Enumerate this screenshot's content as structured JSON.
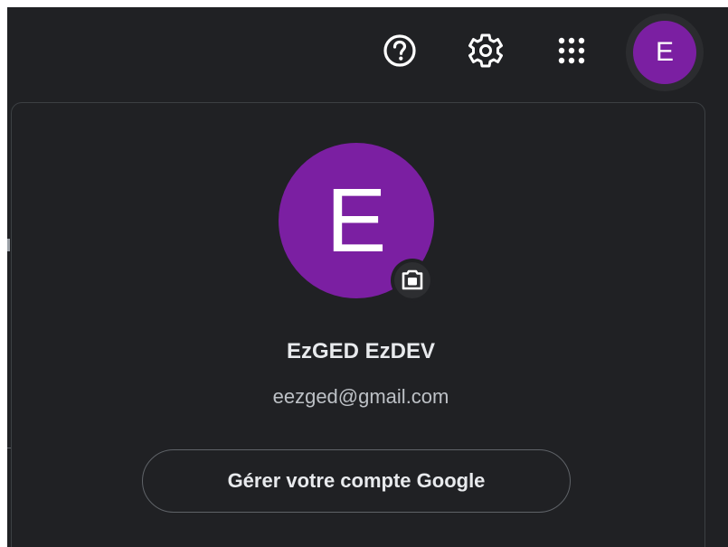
{
  "topbar": {
    "help_icon": "help-circle-icon",
    "settings_icon": "gear-icon",
    "apps_icon": "apps-grid-icon",
    "avatar_initial": "E",
    "avatar_color": "#7b1fa2"
  },
  "account_panel": {
    "avatar_initial": "E",
    "avatar_color": "#7b1fa2",
    "camera_icon": "camera-icon",
    "name": "EzGED EzDEV",
    "email": "eezged@gmail.com",
    "manage_button_label": "Gérer votre compte Google"
  },
  "colors": {
    "background": "#202124",
    "text_primary": "#e8eaed",
    "text_secondary": "#bdc1c6",
    "border": "#5f6368"
  }
}
